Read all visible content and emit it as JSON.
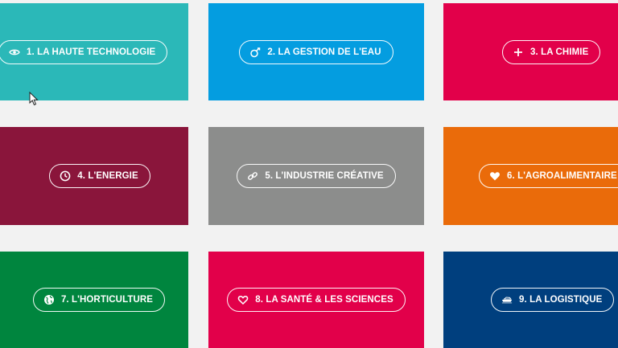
{
  "tiles": [
    {
      "label": "1. LA HAUTE TECHNOLOGIE",
      "color": "#2bb8b8",
      "icon": "eye-icon"
    },
    {
      "label": "2. LA GESTION DE L'EAU",
      "color": "#049de0",
      "icon": "water-tap-icon"
    },
    {
      "label": "3. LA CHIMIE",
      "color": "#e2004a",
      "icon": "plus-icon"
    },
    {
      "label": "4. L'ENERGIE",
      "color": "#8a153b",
      "icon": "clock-icon"
    },
    {
      "label": "5. L'INDUSTRIE CRÉATIVE",
      "color": "#8c8d8c",
      "icon": "link-icon"
    },
    {
      "label": "6. L'AGROALIMENTAIRE",
      "color": "#ea6b0a",
      "icon": "heart-icon"
    },
    {
      "label": "7. L'HORTICULTURE",
      "color": "#00853e",
      "icon": "globe-icon"
    },
    {
      "label": "8. LA SANTÉ & LES SCIENCES",
      "color": "#e2004a",
      "icon": "heart-outline-icon"
    },
    {
      "label": "9. LA LOGISTIQUE",
      "color": "#003f7e",
      "icon": "ship-icon"
    }
  ]
}
